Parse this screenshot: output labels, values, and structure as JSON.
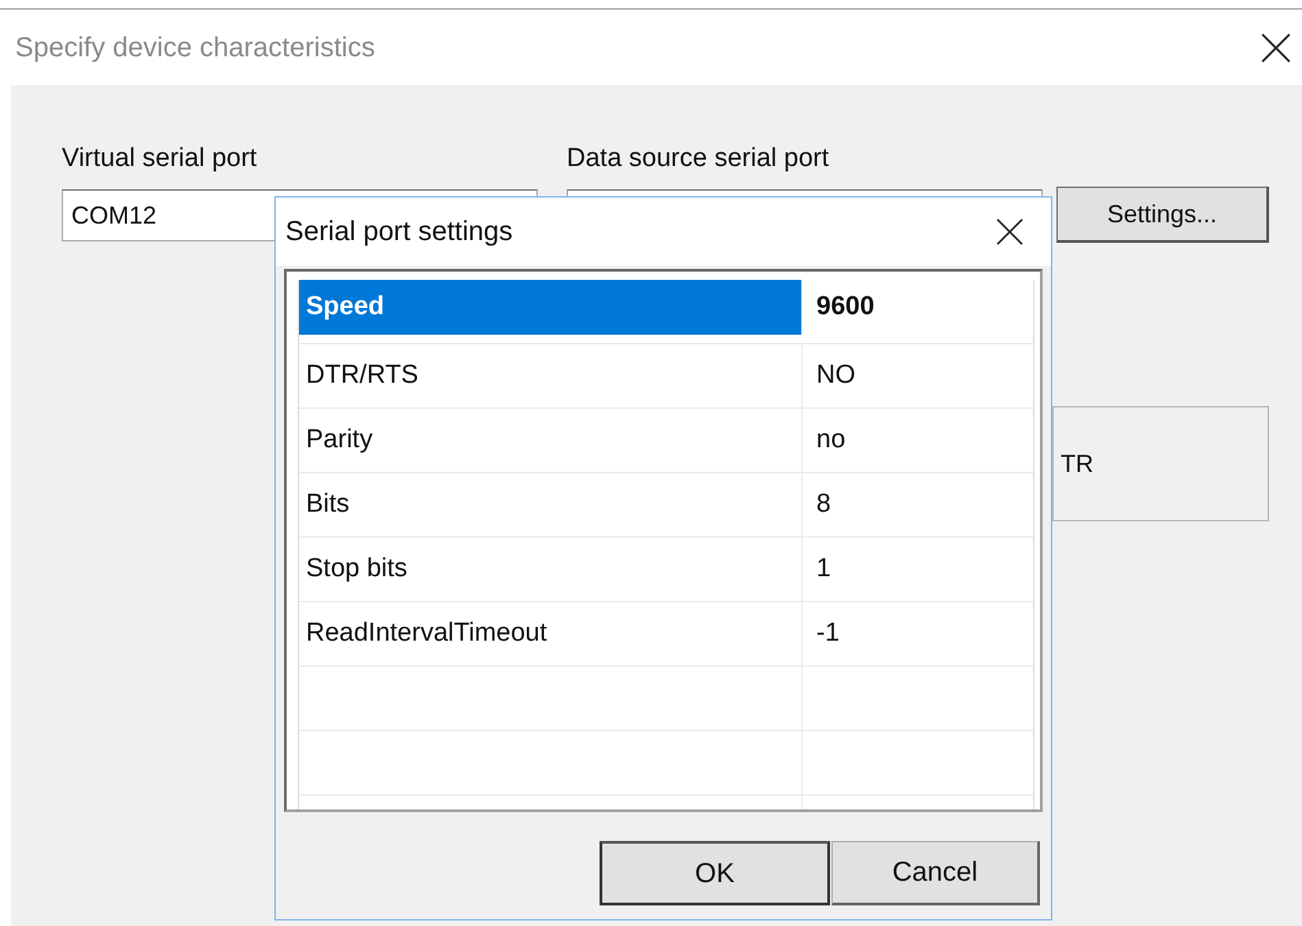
{
  "window": {
    "title": "Specify device characteristics"
  },
  "fields": [
    {
      "label": "Virtual serial port",
      "value": "COM12"
    },
    {
      "label": "Data source serial port"
    }
  ],
  "settings_button": "Settings...",
  "group_box": {
    "text": "TR"
  },
  "popup": {
    "title": "Serial port settings",
    "rows": [
      {
        "name": "Speed",
        "value": "9600",
        "selected": true
      },
      {
        "name": "DTR/RTS",
        "value": "NO",
        "selected": false
      },
      {
        "name": "Parity",
        "value": "no",
        "selected": false
      },
      {
        "name": "Bits",
        "value": "8",
        "selected": false
      },
      {
        "name": "Stop bits",
        "value": "1",
        "selected": false
      },
      {
        "name": "ReadIntervalTimeout",
        "value": "-1",
        "selected": false
      }
    ],
    "buttons": [
      {
        "label": "OK",
        "kind": "default"
      },
      {
        "label": "Cancel",
        "kind": "normal"
      }
    ]
  }
}
